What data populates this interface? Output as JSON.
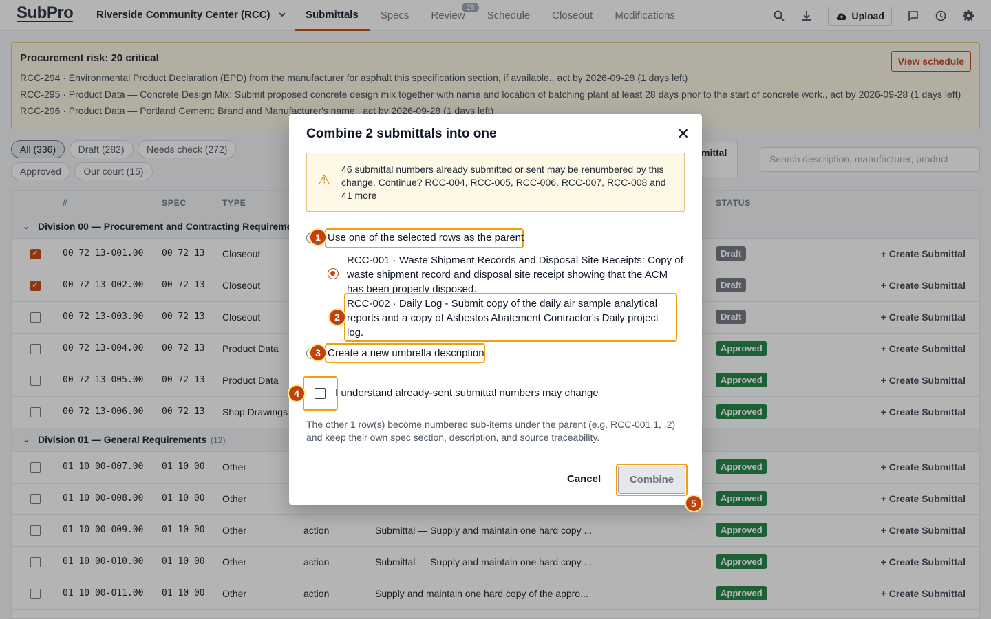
{
  "app": {
    "logo": "SubPro",
    "project": "Riverside Community Center (RCC)"
  },
  "nav": {
    "tabs": [
      {
        "label": "Submittals"
      },
      {
        "label": "Specs"
      },
      {
        "label": "Review",
        "badge": "28"
      },
      {
        "label": "Schedule"
      },
      {
        "label": "Closeout"
      },
      {
        "label": "Modifications"
      }
    ],
    "upload_label": "Upload"
  },
  "banner": {
    "title": "Procurement risk: 20 critical",
    "lines": [
      "RCC-294 · Environmental Product Declaration (EPD) from the manufacturer for asphalt this specification section, if available., act by 2026-09-28 (1 days left)",
      "RCC-295 · Product Data — Concrete Design Mix: Submit proposed concrete design mix together with name and location of batching plant at least 28 days prior to the start of concrete work., act by 2026-09-28 (1 days left)",
      "RCC-296 · Product Data — Portland Cement: Brand and Manufacturer's name., act by 2026-09-28 (1 days left)"
    ],
    "view_schedule": "View schedule"
  },
  "filters": {
    "chips": [
      "All (336)",
      "Draft (282)",
      "Needs check (272)",
      "Approved",
      "Our court (15)"
    ],
    "bulk_fragment": "mittal",
    "search_placeholder": "Search description, manufacturer, product"
  },
  "table": {
    "headers": {
      "num": "#",
      "spec": "SPEC",
      "type": "TYPE",
      "status": "STATUS"
    },
    "groups": [
      {
        "title": "Division 00 — Procurement and Contracting Requirements",
        "count": ""
      },
      {
        "title": "Division 01 — General Requirements",
        "count": "(12)"
      }
    ],
    "create_label": "+ Create Submittal",
    "rows_g0": [
      {
        "num": "00 72 13-001.00",
        "spec": "00 72 13",
        "type": "Closeout",
        "status": "Draft",
        "checked": true
      },
      {
        "num": "00 72 13-002.00",
        "spec": "00 72 13",
        "type": "Closeout",
        "status": "Draft",
        "checked": true
      },
      {
        "num": "00 72 13-003.00",
        "spec": "00 72 13",
        "type": "Closeout",
        "status": "Draft",
        "checked": false
      },
      {
        "num": "00 72 13-004.00",
        "spec": "00 72 13",
        "type": "Product Data",
        "status": "Approved",
        "checked": false
      },
      {
        "num": "00 72 13-005.00",
        "spec": "00 72 13",
        "type": "Product Data",
        "status": "Approved",
        "checked": false
      },
      {
        "num": "00 72 13-006.00",
        "spec": "00 72 13",
        "type": "Shop Drawings",
        "status": "Approved",
        "checked": false
      }
    ],
    "rows_g1": [
      {
        "num": "01 10 00-007.00",
        "spec": "01 10 00",
        "type": "Other",
        "cat": "",
        "desc": "",
        "status": "Approved"
      },
      {
        "num": "01 10 00-008.00",
        "spec": "01 10 00",
        "type": "Other",
        "cat": "",
        "desc": "",
        "status": "Approved"
      },
      {
        "num": "01 10 00-009.00",
        "spec": "01 10 00",
        "type": "Other",
        "cat": "action",
        "desc": "Submittal — Supply and maintain one hard copy ...",
        "status": "Approved"
      },
      {
        "num": "01 10 00-010.00",
        "spec": "01 10 00",
        "type": "Other",
        "cat": "action",
        "desc": "Submittal — Supply and maintain one hard copy ...",
        "status": "Approved"
      },
      {
        "num": "01 10 00-011.00",
        "spec": "01 10 00",
        "type": "Other",
        "cat": "action",
        "desc": "Supply and maintain one hard copy of the appro...",
        "status": "Approved"
      }
    ]
  },
  "modal": {
    "title": "Combine 2 submittals into one",
    "warning": "46 submittal numbers already submitted or sent may be renumbered by this change. Continue? RCC-004, RCC-005, RCC-006, RCC-007, RCC-008 and 41 more",
    "option_parent": "Use one of the selected rows as the parent",
    "child1": "RCC-001 · Waste Shipment Records and Disposal Site Receipts: Copy of waste shipment record and disposal site receipt showing that the ACM has been properly disposed.",
    "child2": "RCC-002 · Daily Log - Submit copy of the daily air sample analytical reports and a copy of Asbestos Abatement Contractor's Daily project log.",
    "option_new": "Create a new umbrella description",
    "ack": "I understand already-sent submittal numbers may change",
    "note": "The other 1 row(s) become numbered sub-items under the parent (e.g. RCC-001.1, .2) and keep their own spec section, description, and source traceability.",
    "cancel": "Cancel",
    "combine": "Combine",
    "markers": [
      "1",
      "2",
      "3",
      "4",
      "5"
    ]
  }
}
